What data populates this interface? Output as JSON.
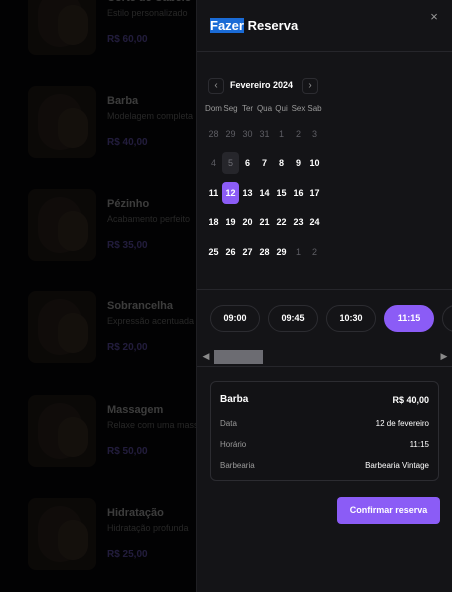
{
  "background_services": [
    {
      "name": "Corte de Cabelo",
      "desc": "Estilo personalizado",
      "price": "R$ 60,00"
    },
    {
      "name": "Barba",
      "desc": "Modelagem completa",
      "price": "R$ 40,00"
    },
    {
      "name": "Pézinho",
      "desc": "Acabamento perfeito",
      "price": "R$ 35,00"
    },
    {
      "name": "Sobrancelha",
      "desc": "Expressão acentuada",
      "price": "R$ 20,00"
    },
    {
      "name": "Massagem",
      "desc": "Relaxe com uma massagem",
      "price": "R$ 50,00"
    },
    {
      "name": "Hidratação",
      "desc": "Hidratação profunda",
      "price": "R$ 25,00"
    }
  ],
  "sheet": {
    "title_highlight": "Fazer",
    "title_rest": " Reserva",
    "close_icon": "×"
  },
  "calendar": {
    "month_label": "Fevereiro 2024",
    "prev_icon": "‹",
    "next_icon": "›",
    "weekdays": [
      "Dom",
      "Seg",
      "Ter",
      "Qua",
      "Qui",
      "Sex",
      "Sab"
    ],
    "weeks": [
      [
        {
          "d": "28",
          "s": "out"
        },
        {
          "d": "29",
          "s": "out"
        },
        {
          "d": "30",
          "s": "out"
        },
        {
          "d": "31",
          "s": "out"
        },
        {
          "d": "1",
          "s": "out"
        },
        {
          "d": "2",
          "s": "out"
        },
        {
          "d": "3",
          "s": "out"
        }
      ],
      [
        {
          "d": "4",
          "s": "out"
        },
        {
          "d": "5",
          "s": "today"
        },
        {
          "d": "6",
          "s": "in"
        },
        {
          "d": "7",
          "s": "in"
        },
        {
          "d": "8",
          "s": "in"
        },
        {
          "d": "9",
          "s": "in"
        },
        {
          "d": "10",
          "s": "in"
        }
      ],
      [
        {
          "d": "11",
          "s": "in"
        },
        {
          "d": "12",
          "s": "sel"
        },
        {
          "d": "13",
          "s": "in"
        },
        {
          "d": "14",
          "s": "in"
        },
        {
          "d": "15",
          "s": "in"
        },
        {
          "d": "16",
          "s": "in"
        },
        {
          "d": "17",
          "s": "in"
        }
      ],
      [
        {
          "d": "18",
          "s": "in"
        },
        {
          "d": "19",
          "s": "in"
        },
        {
          "d": "20",
          "s": "in"
        },
        {
          "d": "21",
          "s": "in"
        },
        {
          "d": "22",
          "s": "in"
        },
        {
          "d": "23",
          "s": "in"
        },
        {
          "d": "24",
          "s": "in"
        }
      ],
      [
        {
          "d": "25",
          "s": "in"
        },
        {
          "d": "26",
          "s": "in"
        },
        {
          "d": "27",
          "s": "in"
        },
        {
          "d": "28",
          "s": "in"
        },
        {
          "d": "29",
          "s": "in"
        },
        {
          "d": "1",
          "s": "out"
        },
        {
          "d": "2",
          "s": "out"
        }
      ]
    ]
  },
  "times": [
    {
      "label": "09:00",
      "selected": false
    },
    {
      "label": "09:45",
      "selected": false
    },
    {
      "label": "10:30",
      "selected": false
    },
    {
      "label": "11:15",
      "selected": true
    },
    {
      "label": "12:00",
      "selected": false
    }
  ],
  "scroll": {
    "left_icon": "◀",
    "right_icon": "▶"
  },
  "summary": {
    "service": "Barba",
    "price": "R$ 40,00",
    "rows": [
      {
        "label": "Data",
        "value": "12 de fevereiro"
      },
      {
        "label": "Horário",
        "value": "11:15"
      },
      {
        "label": "Barbearia",
        "value": "Barbearia Vintage"
      }
    ]
  },
  "confirm_label": "Confirmar reserva",
  "colors": {
    "accent": "#8b5cf6",
    "panel": "#141417"
  }
}
